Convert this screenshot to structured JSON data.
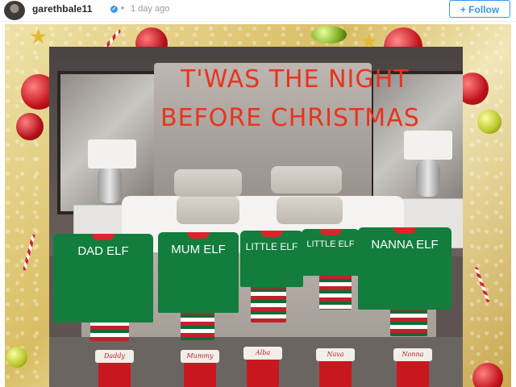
{
  "header": {
    "username": "garethbale11",
    "verified_icon": "verified-badge-icon",
    "separator": "•",
    "timestamp": "1 day ago",
    "follow_label": "+ Follow"
  },
  "post": {
    "caption_line1": "T'WAS THE NIGHT",
    "caption_line2": "BEFORE CHRISTMAS",
    "shirts": [
      {
        "label": "DAD ELF"
      },
      {
        "label": "MUM ELF"
      },
      {
        "label": "LITTLE ELF"
      },
      {
        "label": "LITTLE ELF"
      },
      {
        "label": "NANNA ELF"
      }
    ],
    "stockings": [
      {
        "name": "Daddy"
      },
      {
        "name": "Mummy"
      },
      {
        "name": "Alba"
      },
      {
        "name": "Nava"
      },
      {
        "name": "Nonna"
      }
    ]
  },
  "colors": {
    "follow_blue": "#3897f0",
    "caption_red": "#e8341e",
    "elf_green": "#127d3d"
  }
}
